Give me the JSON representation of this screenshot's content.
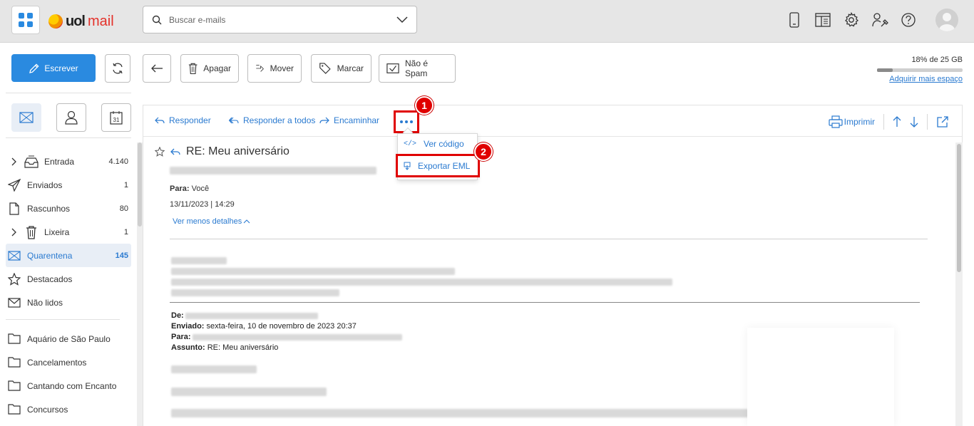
{
  "header": {
    "logo_uol": "uol",
    "logo_mail": "mail",
    "search_placeholder": "Buscar e-mails"
  },
  "toolbar": {
    "compose_label": "Escrever",
    "delete_label": "Apagar",
    "move_label": "Mover",
    "mark_label": "Marcar",
    "not_spam_label": "Não é Spam"
  },
  "quota": {
    "text": "18% de 25 GB",
    "percent": 18,
    "link": "Adquirir mais espaço"
  },
  "folders": [
    {
      "label": "Entrada",
      "count": "4.140",
      "icon": "inbox-icon",
      "expandable": true
    },
    {
      "label": "Enviados",
      "count": "1",
      "icon": "send-icon",
      "expandable": false
    },
    {
      "label": "Rascunhos",
      "count": "80",
      "icon": "draft-icon",
      "expandable": false
    },
    {
      "label": "Lixeira",
      "count": "1",
      "icon": "trash-icon",
      "expandable": true
    },
    {
      "label": "Quarentena",
      "count": "145",
      "icon": "quarantine-icon",
      "expandable": false,
      "active": true
    },
    {
      "label": "Destacados",
      "count": "",
      "icon": "star-icon",
      "expandable": false
    },
    {
      "label": "Não lidos",
      "count": "",
      "icon": "envelope-icon",
      "expandable": false
    }
  ],
  "custom_folders": [
    {
      "label": "Aquário de São Paulo"
    },
    {
      "label": "Cancelamentos"
    },
    {
      "label": "Cantando com Encanto"
    },
    {
      "label": "Concursos"
    }
  ],
  "message_actions": {
    "reply": "Responder",
    "reply_all": "Responder a todos",
    "forward": "Encaminhar",
    "print": "Imprimir"
  },
  "more_menu": {
    "view_source": "Ver código",
    "export_eml": "Exportar EML"
  },
  "annotations": {
    "step1": "1",
    "step2": "2",
    "color": "#e00000"
  },
  "message": {
    "subject": "RE: Meu aniversário",
    "to_label": "Para:",
    "to_value": "Você",
    "datetime": "13/11/2023 | 14:29",
    "less_details": "Ver menos detalhes"
  },
  "quoted": {
    "from_label": "De:",
    "sent_label": "Enviado:",
    "sent_value": "sexta-feira, 10 de novembro de 2023 20:37",
    "to_label": "Para:",
    "subject_label": "Assunto:",
    "subject_value": "RE: Meu aniversário"
  },
  "colors": {
    "accent": "#2a8ae0",
    "link": "#2a7ad0",
    "active_bg": "#e8eef6"
  }
}
